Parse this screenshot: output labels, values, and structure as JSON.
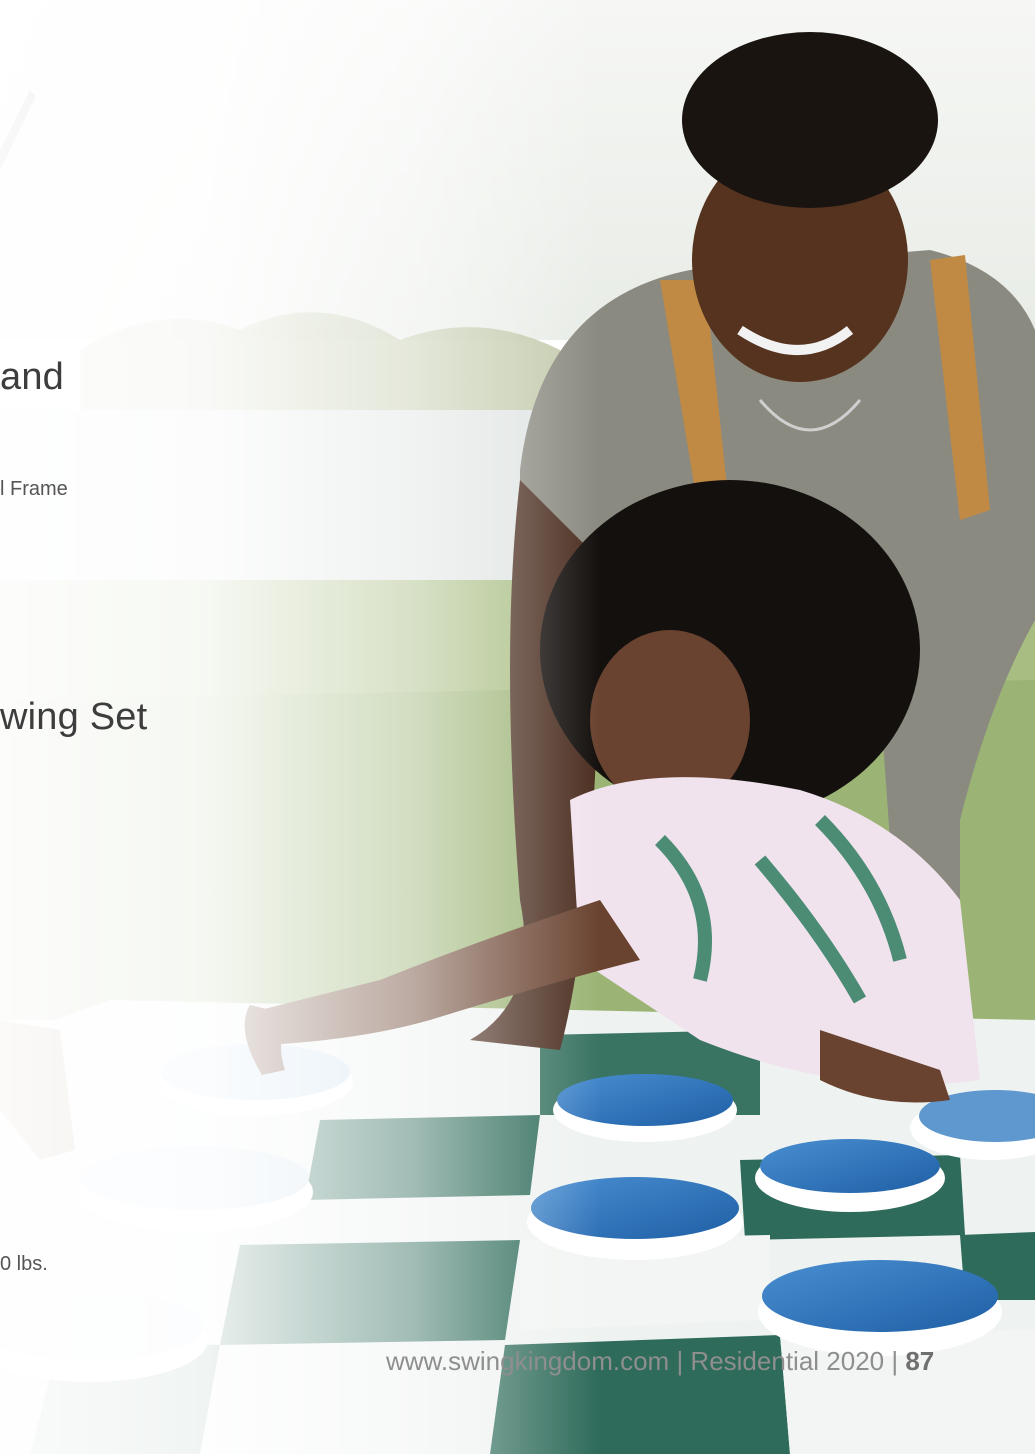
{
  "fragments": {
    "heading_1": "and",
    "subline_1": "l Frame",
    "heading_2": "wing Set",
    "subline_2": "0 lbs."
  },
  "footer": {
    "website": "www.swingkingdom.com",
    "separator_1": " | ",
    "catalog": "Residential 2020",
    "separator_2": " | ",
    "page_number": "87"
  },
  "photo": {
    "subject": "Woman and child playing giant outdoor checkers on a checkerboard mat",
    "colors": {
      "board_dark": "#2e6b5a",
      "board_light": "#f2f5f3",
      "piece_blue": "#2d6fb4",
      "sky": "#f4f6f4",
      "grass": "#9fb878"
    }
  }
}
